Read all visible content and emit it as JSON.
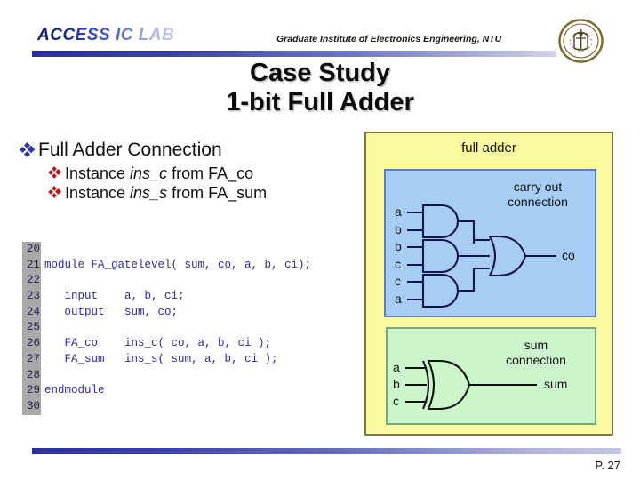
{
  "header": {
    "logo_text": "ACCESS IC LAB",
    "subtitle": "Graduate Institute of Electronics Engineering, NTU",
    "seal_icon": "ntu-seal-icon"
  },
  "title": {
    "line1": "Case Study",
    "line2": "1-bit Full Adder"
  },
  "bullets": {
    "level1": "Full Adder Connection",
    "level2": [
      {
        "prefix": "Instance ",
        "emphasis": "ins_c",
        "suffix": " from FA_co"
      },
      {
        "prefix": "Instance ",
        "emphasis": "ins_s",
        "suffix": " from FA_sum"
      }
    ]
  },
  "code": {
    "lines": [
      {
        "number": "20",
        "text": ""
      },
      {
        "number": "21",
        "text": "module FA_gatelevel( sum, co, a, b, ci);"
      },
      {
        "number": "22",
        "text": ""
      },
      {
        "number": "23",
        "text": "   input    a, b, ci;"
      },
      {
        "number": "24",
        "text": "   output   sum, co;"
      },
      {
        "number": "25",
        "text": ""
      },
      {
        "number": "26",
        "text": "   FA_co    ins_c( co, a, b, ci );"
      },
      {
        "number": "27",
        "text": "   FA_sum   ins_s( sum, a, b, ci );"
      },
      {
        "number": "28",
        "text": ""
      },
      {
        "number": "29",
        "text": "endmodule"
      },
      {
        "number": "30",
        "text": ""
      }
    ]
  },
  "diagram": {
    "outer_label": "full adder",
    "carry": {
      "caption_line1": "carry out",
      "caption_line2": "connection",
      "inputs": [
        "a",
        "b",
        "b",
        "c",
        "c",
        "a"
      ],
      "output": "co"
    },
    "sum": {
      "caption_line1": "sum",
      "caption_line2": "connection",
      "inputs": [
        "a",
        "b",
        "c"
      ],
      "output": "sum"
    }
  },
  "footer": {
    "page": "P. 27"
  },
  "colors": {
    "outer_fill": "#fbf9a0",
    "outer_border": "#7b7a3c",
    "carry_fill": "#a8cdf5",
    "carry_border": "#5c7fb5",
    "sum_fill": "#ccf5cc",
    "sum_border": "#7aa87a",
    "code_text": "#2d2d8c",
    "gutter": "#a9a9a9",
    "bullet_l1": "#2c35a8",
    "bullet_l2": "#c01818"
  }
}
